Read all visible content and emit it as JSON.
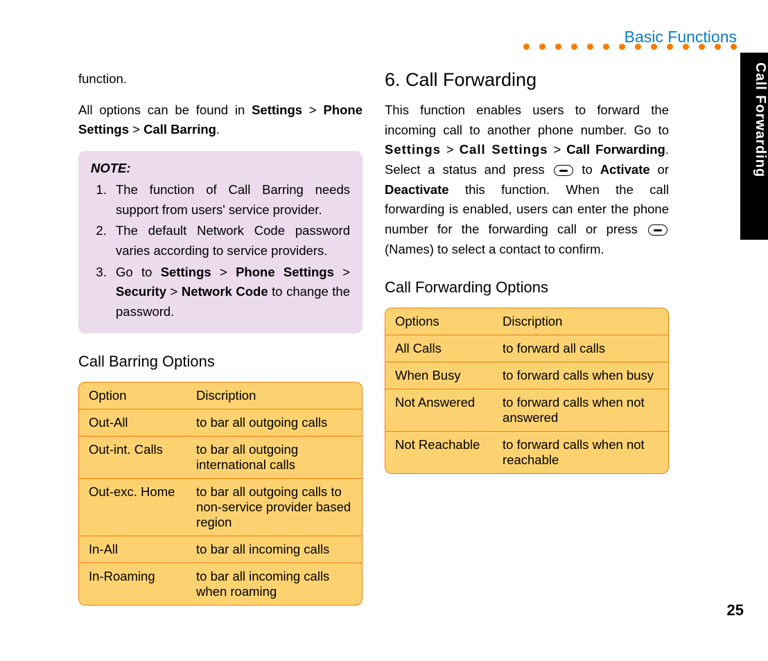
{
  "header": {
    "title": "Basic Functions"
  },
  "side_tab": "Call Forwarding",
  "page_number": "25",
  "left": {
    "p1": "function.",
    "p2_pre": "All options can be found in ",
    "p2_b1": "Settings",
    "p2_sep1": " > ",
    "p2_b2": "Phone Settings",
    "p2_sep2": " > ",
    "p2_b3": "Call Barring",
    "p2_end": ".",
    "note_title": "NOTE:",
    "note1": "The function of Call Barring needs support from users' service provider.",
    "note2": "The default Network Code password varies according to service providers.",
    "note3_pre": "Go to ",
    "note3_b1": "Settings",
    "note3_s1": " > ",
    "note3_b2": "Phone Settings",
    "note3_s2": " > ",
    "note3_b3": "Security",
    "note3_s3": " > ",
    "note3_b4": "Network Code",
    "note3_post": " to change the password.",
    "sub_heading": "Call Barring Options",
    "table": {
      "h1": "Option",
      "h2": "Discription",
      "rows": [
        {
          "opt": "Out-All",
          "desc": "to bar all outgoing calls"
        },
        {
          "opt": "Out-int. Calls",
          "desc": "to bar all outgoing international calls"
        },
        {
          "opt": "Out-exc. Home",
          "desc": "to bar all outgoing calls to non-service provider based region"
        },
        {
          "opt": "In-All",
          "desc": "to bar all incoming calls"
        },
        {
          "opt": "In-Roaming",
          "desc": "to bar all incoming calls when roaming"
        }
      ]
    }
  },
  "right": {
    "heading": "6. Call Forwarding",
    "p_pre": "This function enables users to forward the incoming call to another phone number. Go to ",
    "p_b1": "Settings",
    "p_s1": " > ",
    "p_b2": "Call Settings",
    "p_s2": " > ",
    "p_b3": "Call Forwarding",
    "p_mid1": ". Select a status and press ",
    "p_mid2": " to ",
    "p_b4": "Activate",
    "p_or": " or ",
    "p_b5": "Deactivate",
    "p_mid3": " this function. When the call forwarding is enabled, users can enter the phone number for the forwarding call or press ",
    "p_mid4": " (Names) to select a contact to confirm.",
    "sub_heading": "Call Forwarding Options",
    "table": {
      "h1": "Options",
      "h2": "Discription",
      "rows": [
        {
          "opt": "All Calls",
          "desc": "to forward all calls"
        },
        {
          "opt": "When Busy",
          "desc": "to forward calls when busy"
        },
        {
          "opt": "Not Answered",
          "desc": "to forward calls when not answered"
        },
        {
          "opt": "Not Reachable",
          "desc": "to forward calls when not reachable"
        }
      ]
    }
  }
}
